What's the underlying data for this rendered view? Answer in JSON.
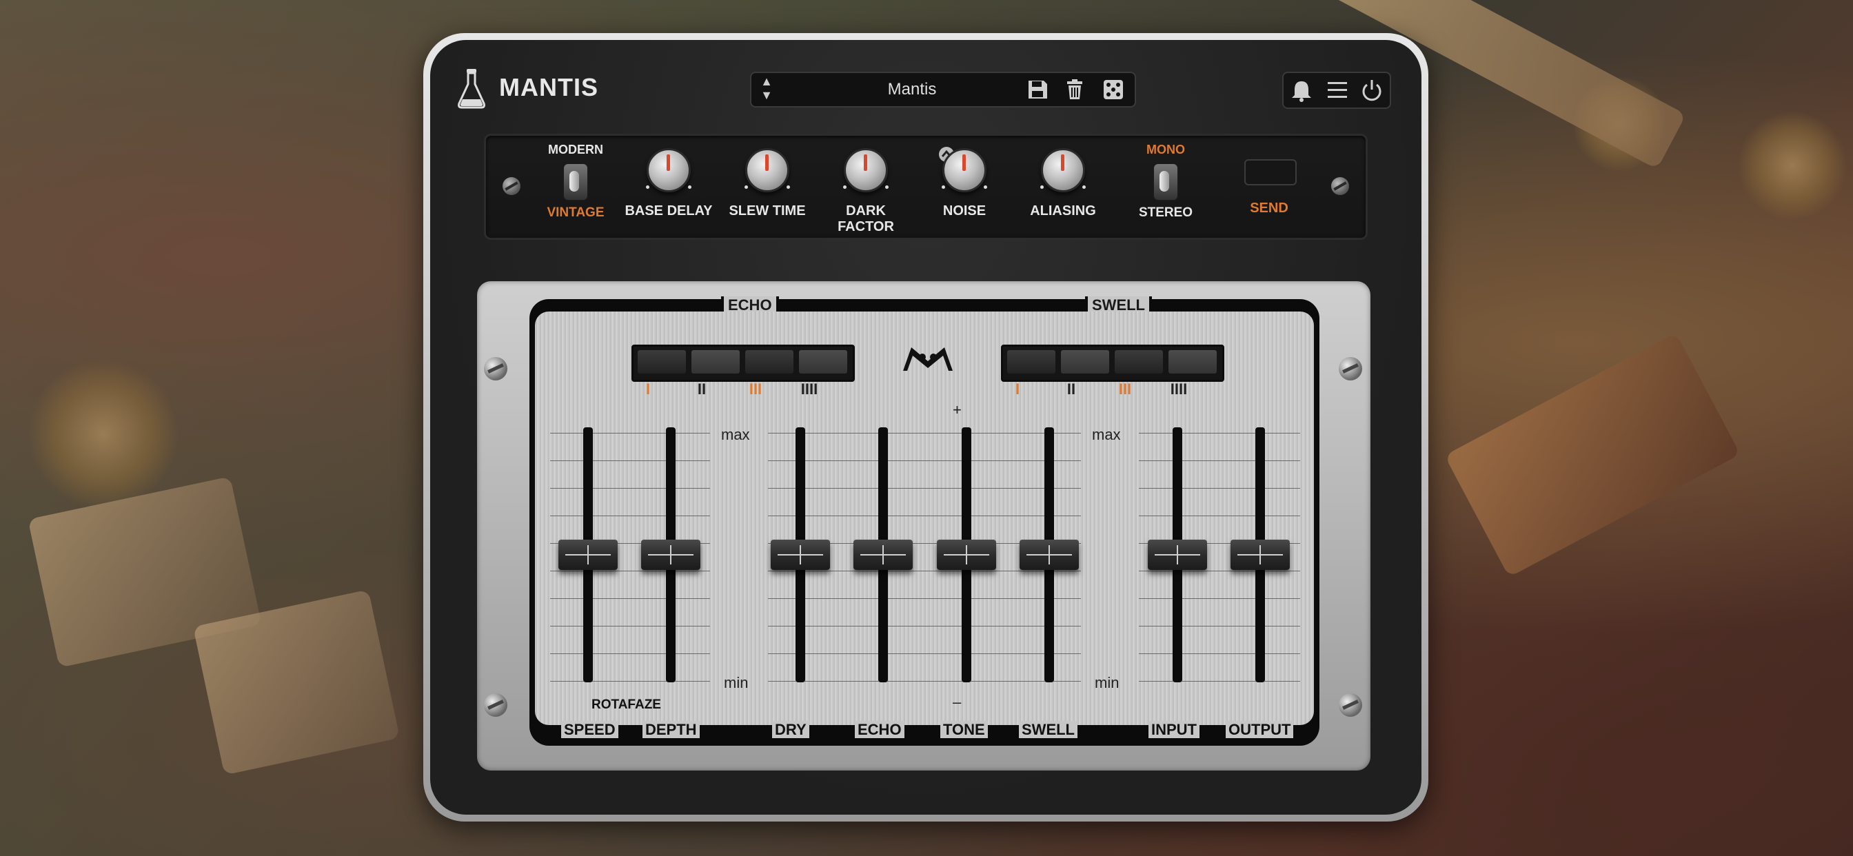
{
  "header": {
    "plugin_name": "MANTIS",
    "preset_name": "Mantis"
  },
  "rack": {
    "mode_switch": {
      "top": "MODERN",
      "bottom": "VINTAGE",
      "active": "VINTAGE"
    },
    "knobs": [
      {
        "label": "BASE DELAY"
      },
      {
        "label": "SLEW TIME"
      },
      {
        "label": "DARK FACTOR"
      },
      {
        "label": "NOISE"
      },
      {
        "label": "ALIASING"
      }
    ],
    "stereo_switch": {
      "top": "MONO",
      "bottom": "STEREO",
      "active": "MONO"
    },
    "send_label": "SEND"
  },
  "panel": {
    "echo_title": "ECHO",
    "swell_title": "SWELL",
    "echo_modes": [
      "I",
      "II",
      "III",
      "IIII"
    ],
    "swell_modes": [
      "I",
      "II",
      "III",
      "IIII"
    ],
    "max_label": "max",
    "min_label": "min",
    "plus_label": "+",
    "minus_label": "–",
    "rotafaze_label": "ROTAFAZE",
    "faders": [
      {
        "label": "SPEED",
        "level": 0.5
      },
      {
        "label": "DEPTH",
        "level": 0.5
      },
      {
        "label": "DRY",
        "level": 0.5
      },
      {
        "label": "ECHO",
        "level": 0.5
      },
      {
        "label": "TONE",
        "level": 0.5
      },
      {
        "label": "SWELL",
        "level": 0.5
      },
      {
        "label": "INPUT",
        "level": 0.5
      },
      {
        "label": "OUTPUT",
        "level": 0.5
      }
    ]
  },
  "colors": {
    "accent_orange": "#e07a2f",
    "label_white": "#e8e8e8"
  }
}
